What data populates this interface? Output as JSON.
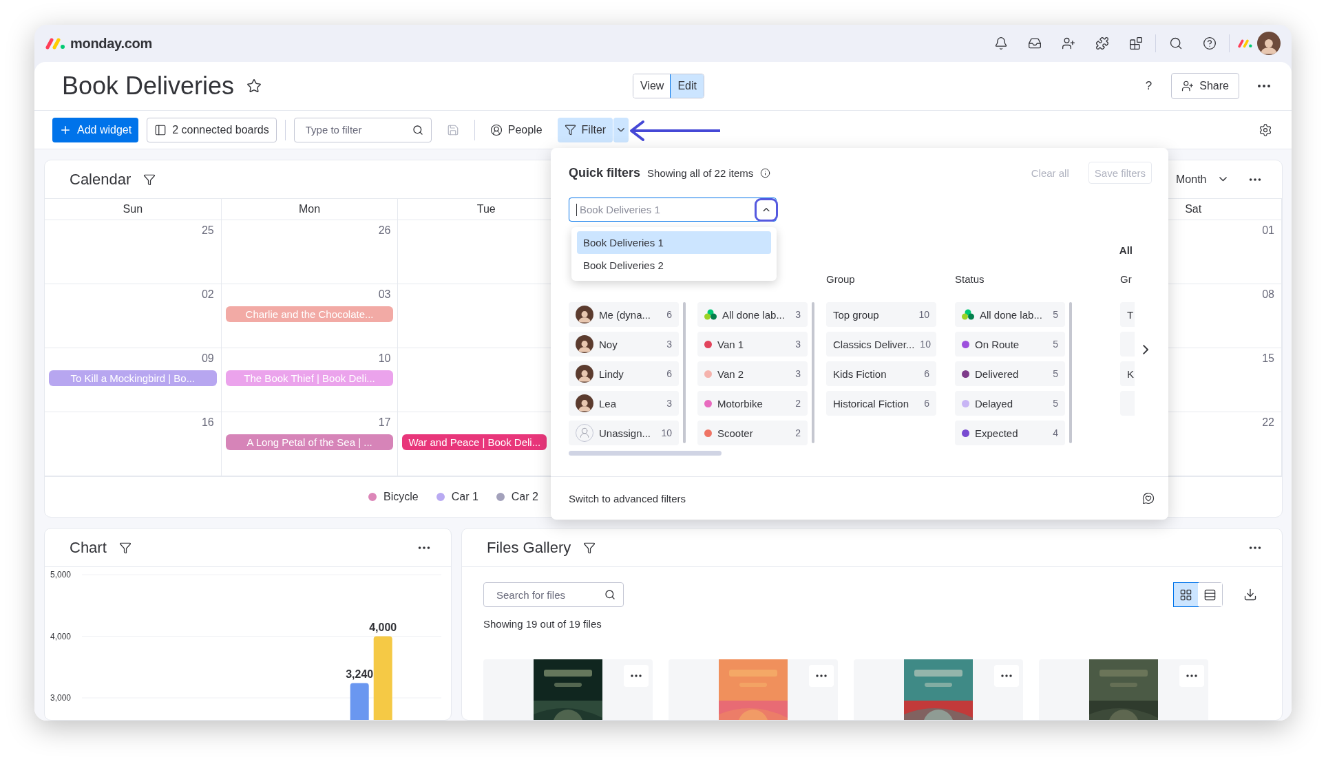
{
  "topbar": {
    "logo_text": "monday.com"
  },
  "page": {
    "title": "Book Deliveries",
    "modes": [
      {
        "label": "View",
        "selected": false
      },
      {
        "label": "Edit",
        "selected": true
      }
    ],
    "help": "?",
    "share": "Share"
  },
  "toolbar": {
    "add_widget": "Add widget",
    "connected_boards": "2 connected boards",
    "filter_placeholder": "Type to filter",
    "people": "People",
    "filter": {
      "label": "Filter",
      "open": true
    }
  },
  "calendar": {
    "title": "Calendar",
    "view": "Month",
    "days": [
      "Sun",
      "Mon",
      "Tue",
      "Sat"
    ],
    "weeks": [
      {
        "cells": [
          {
            "kind": "day",
            "date": "25"
          },
          {
            "kind": "day",
            "date": "26"
          },
          {
            "kind": "blank"
          },
          {
            "kind": "day",
            "date": "01"
          }
        ]
      },
      {
        "cells": [
          {
            "kind": "day",
            "date": "02"
          },
          {
            "kind": "day",
            "date": "03",
            "event": {
              "title": "Charlie and the Chocolate...",
              "color": "#f2aaa5"
            }
          },
          {
            "kind": "blank"
          },
          {
            "kind": "day",
            "date": "08"
          }
        ]
      },
      {
        "cells": [
          {
            "kind": "day",
            "date": "09",
            "event": {
              "title": "To Kill a Mockingbird | Bo...",
              "color": "#b7a6f0"
            }
          },
          {
            "kind": "day",
            "date": "10",
            "event": {
              "title": "The Book Thief | Book Deli...",
              "color": "#eba3ec"
            }
          },
          {
            "kind": "blank"
          },
          {
            "kind": "day",
            "date": "15"
          }
        ]
      },
      {
        "cells": [
          {
            "kind": "day",
            "date": "16"
          },
          {
            "kind": "day",
            "date": "17",
            "event": {
              "title": "A Long Petal of the Sea | ...",
              "color": "#d684b8"
            }
          },
          {
            "kind": "blank",
            "event": {
              "title": "War and Peace | Book Deli...",
              "color": "#e8367a"
            }
          },
          {
            "kind": "day",
            "date": "22"
          }
        ]
      }
    ],
    "legend": [
      {
        "label": "Bicycle",
        "color": "#dc86b8"
      },
      {
        "label": "Car 1",
        "color": "#b9aaf2"
      },
      {
        "label": "Car 2",
        "color": "#a3a1bb"
      }
    ]
  },
  "quick_filters": {
    "title": "Quick filters",
    "summary": "Showing all of 22 items",
    "clear": "Clear all",
    "save": "Save filters",
    "board_select": {
      "value": "Book Deliveries 1",
      "expanded": true,
      "options": [
        {
          "label": "Book Deliveries 1",
          "selected": true
        },
        {
          "label": "Book Deliveries 2",
          "selected": false
        }
      ]
    },
    "all_label": "All",
    "columns": [
      {
        "items": [
          {
            "kind": "avatar",
            "label": "Me (dyna...",
            "count": "6"
          },
          {
            "kind": "avatar",
            "label": "Noy",
            "count": "3"
          },
          {
            "kind": "avatar",
            "label": "Lindy",
            "count": "6"
          },
          {
            "kind": "avatar",
            "label": "Lea",
            "count": "3"
          },
          {
            "kind": "person-outline",
            "label": "Unassign...",
            "count": "10"
          }
        ]
      },
      {
        "items": [
          {
            "kind": "cluster",
            "label": "All done lab...",
            "count": "3"
          },
          {
            "kind": "dot",
            "label": "Van 1",
            "count": "3",
            "color": "#e2445c"
          },
          {
            "kind": "dot",
            "label": "Van 2",
            "count": "3",
            "color": "#f5b3ad"
          },
          {
            "kind": "dot",
            "label": "Motorbike",
            "count": "2",
            "color": "#e86bbf"
          },
          {
            "kind": "dot",
            "label": "Scooter",
            "count": "2",
            "color": "#ef7465"
          }
        ]
      },
      {
        "heading": "Group",
        "items": [
          {
            "kind": "plain",
            "label": "Top group",
            "count": "10"
          },
          {
            "kind": "plain",
            "label": "Classics Deliver...",
            "count": "10"
          },
          {
            "kind": "plain",
            "label": "Kids Fiction",
            "count": "6"
          },
          {
            "kind": "plain",
            "label": "Historical Fiction",
            "count": "6"
          }
        ]
      },
      {
        "heading": "Status",
        "items": [
          {
            "kind": "cluster",
            "label": "All done lab...",
            "count": "5"
          },
          {
            "kind": "dot",
            "label": "On Route",
            "count": "5",
            "color": "#9d50dd"
          },
          {
            "kind": "dot",
            "label": "Delivered",
            "count": "5",
            "color": "#7e3b8a"
          },
          {
            "kind": "dot",
            "label": "Delayed",
            "count": "5",
            "color": "#c8b5f5"
          },
          {
            "kind": "dot",
            "label": "Expected",
            "count": "4",
            "color": "#784bd1"
          }
        ]
      },
      {
        "heading": "Gr",
        "items": [
          {
            "kind": "plain",
            "label": "T"
          },
          {
            "kind": "plain"
          },
          {
            "kind": "plain",
            "label": "K"
          },
          {
            "kind": "plain"
          }
        ]
      }
    ],
    "footer": "Switch to advanced filters"
  },
  "chart_widget": {
    "title": "Chart",
    "chart_data": {
      "type": "bar",
      "series": [
        {
          "color": "#6a97f0",
          "values": [
            3240
          ],
          "value_labels": [
            "3,240"
          ]
        },
        {
          "color": "#f5c945",
          "values": [
            4000
          ],
          "value_labels": [
            "4,000"
          ]
        }
      ],
      "ylim": [
        3000,
        5000
      ],
      "yticks": [
        {
          "value": 3000,
          "label": "3,000"
        },
        {
          "value": 4000,
          "label": "4,000"
        },
        {
          "value": 5000,
          "label": "5,000"
        }
      ]
    }
  },
  "files_gallery": {
    "title": "Files Gallery",
    "search_placeholder": "Search for files",
    "summary": "Showing 19 out of 19 files",
    "views": [
      {
        "kind": "grid",
        "selected": true
      },
      {
        "kind": "list",
        "selected": false
      }
    ]
  }
}
